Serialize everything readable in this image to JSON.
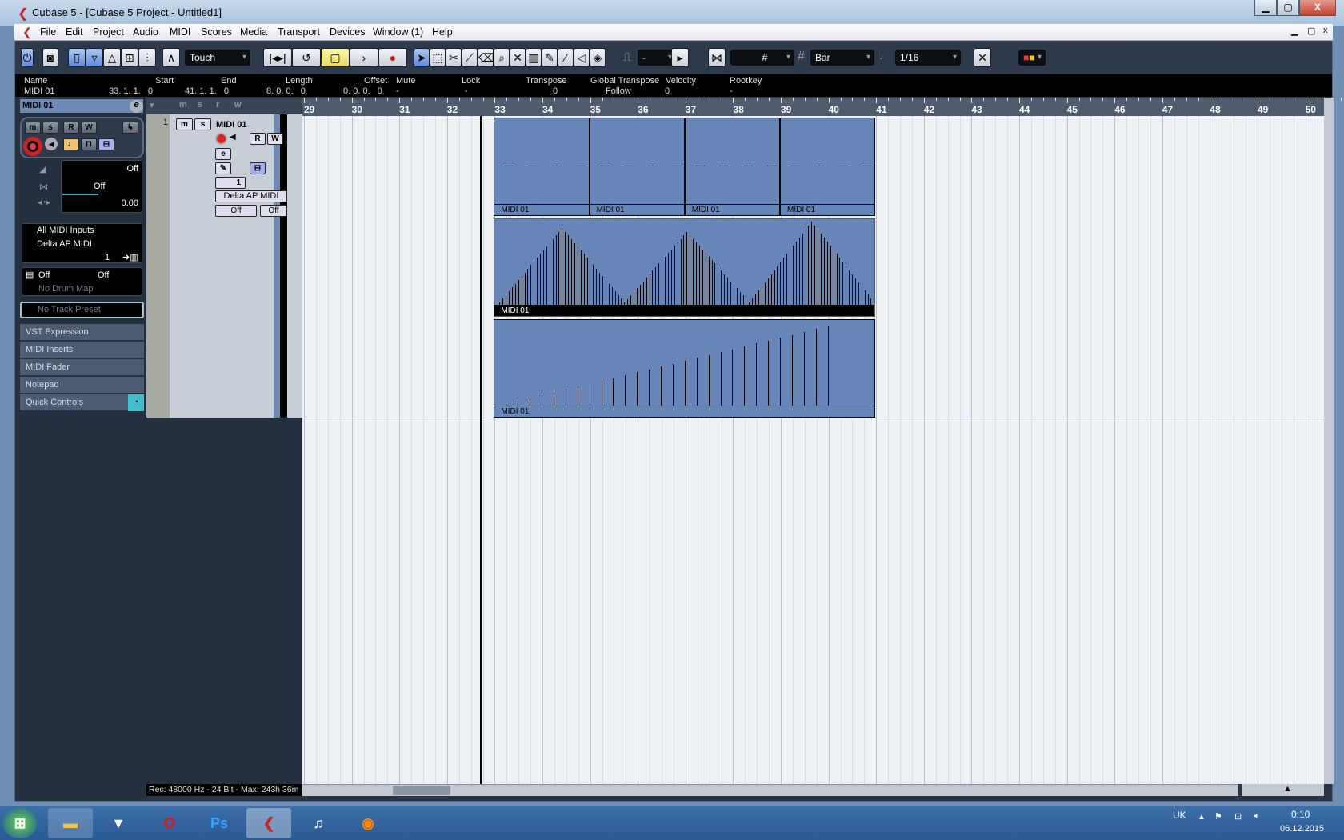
{
  "window": {
    "title": "Cubase 5 - [Cubase 5 Project - Untitled1]",
    "minimize": "▁",
    "restore": "▢",
    "close": "X"
  },
  "menu": [
    "File",
    "Edit",
    "Project",
    "Audio",
    "MIDI",
    "Scores",
    "Media",
    "Transport",
    "Devices",
    "Window (1)",
    "Help"
  ],
  "toolbar": {
    "automation_mode": "Touch",
    "nudge": "-",
    "grid_type": "Bar",
    "quantize": "1/16",
    "grid_icon": "#"
  },
  "info_line": {
    "headers": [
      "Name",
      "Start",
      "End",
      "Length",
      "Offset",
      "Mute",
      "Lock",
      "Transpose",
      "Global Transpose",
      "Velocity",
      "Rootkey"
    ],
    "values": [
      "MIDI 01",
      "33. 1. 1.   0",
      "41. 1. 1.   0",
      "8. 0. 0.   0",
      "0. 0. 0.   0",
      "-",
      "-",
      "0",
      "Follow",
      "0",
      "-"
    ]
  },
  "inspector": {
    "track_name": "MIDI 01",
    "buttons": [
      "m",
      "s",
      "R",
      "W"
    ],
    "volume": "Off",
    "pan": "Off",
    "delay": "0.00",
    "input": "All MIDI Inputs",
    "output": "Delta AP MIDI",
    "channel": "1",
    "bank": "Off",
    "program": "Off",
    "drum_map": "No Drum Map",
    "track_preset": "No Track Preset",
    "sections": [
      "VST Expression",
      "MIDI Inserts",
      "MIDI Fader",
      "Notepad",
      "Quick Controls"
    ]
  },
  "track": {
    "number": "1",
    "name": "MIDI 01",
    "mute": "m",
    "solo": "s",
    "read": "R",
    "write": "W",
    "channel": "1",
    "output": "Delta AP MIDI",
    "bank": "Off",
    "program": "Off"
  },
  "tracklist_header": [
    "m",
    "s",
    "r",
    "w"
  ],
  "ruler": {
    "bars": [
      "29",
      "30",
      "31",
      "32",
      "33",
      "34",
      "35",
      "36",
      "37",
      "38",
      "39",
      "40",
      "41",
      "42",
      "43",
      "44",
      "45",
      "46",
      "47",
      "48",
      "49",
      "50"
    ]
  },
  "parts": {
    "row1": [
      "MIDI 01",
      "MIDI 01",
      "MIDI 01",
      "MIDI 01"
    ],
    "row2": "MIDI 01",
    "row3": "MIDI 01"
  },
  "status": "Rec: 48000 Hz - 24 Bit - Max: 243h 36m",
  "taskbar": {
    "language": "UK",
    "time": "0:10",
    "date": "06.12.2015"
  }
}
